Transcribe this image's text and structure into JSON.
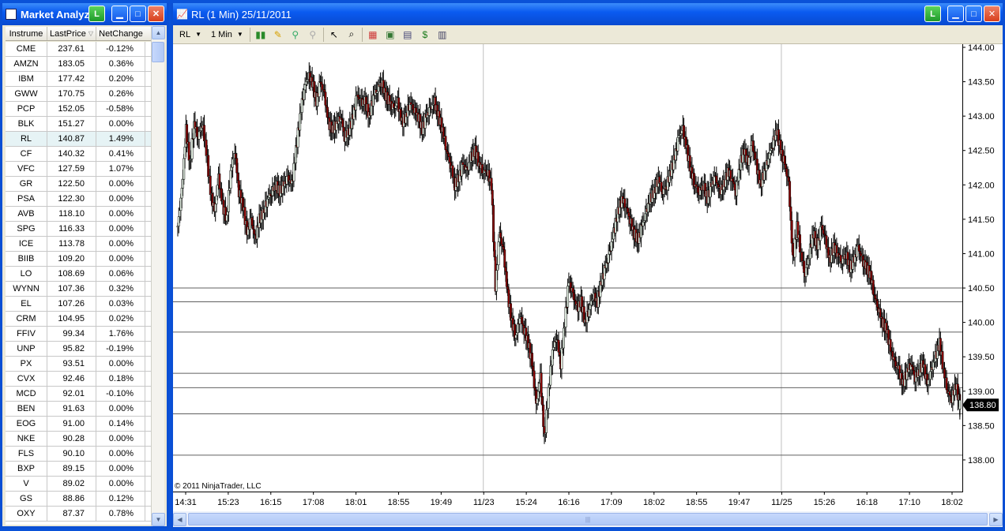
{
  "left_window": {
    "title": "Market Analyz",
    "link_label": "L",
    "columns": [
      "Instrume",
      "LastPrice",
      "NetChange"
    ],
    "rows": [
      [
        "CME",
        "237.61",
        "-0.12%"
      ],
      [
        "AMZN",
        "183.05",
        "0.36%"
      ],
      [
        "IBM",
        "177.42",
        "0.20%"
      ],
      [
        "GWW",
        "170.75",
        "0.26%"
      ],
      [
        "PCP",
        "152.05",
        "-0.58%"
      ],
      [
        "BLK",
        "151.27",
        "0.00%"
      ],
      [
        "RL",
        "140.87",
        "1.49%"
      ],
      [
        "CF",
        "140.32",
        "0.41%"
      ],
      [
        "VFC",
        "127.59",
        "1.07%"
      ],
      [
        "GR",
        "122.50",
        "0.00%"
      ],
      [
        "PSA",
        "122.30",
        "0.00%"
      ],
      [
        "AVB",
        "118.10",
        "0.00%"
      ],
      [
        "SPG",
        "116.33",
        "0.00%"
      ],
      [
        "ICE",
        "113.78",
        "0.00%"
      ],
      [
        "BIIB",
        "109.20",
        "0.00%"
      ],
      [
        "LO",
        "108.69",
        "0.06%"
      ],
      [
        "WYNN",
        "107.36",
        "0.32%"
      ],
      [
        "EL",
        "107.26",
        "0.03%"
      ],
      [
        "CRM",
        "104.95",
        "0.02%"
      ],
      [
        "FFIV",
        "99.34",
        "1.76%"
      ],
      [
        "UNP",
        "95.82",
        "-0.19%"
      ],
      [
        "PX",
        "93.51",
        "0.00%"
      ],
      [
        "CVX",
        "92.46",
        "0.18%"
      ],
      [
        "MCD",
        "92.01",
        "-0.10%"
      ],
      [
        "BEN",
        "91.63",
        "0.00%"
      ],
      [
        "EOG",
        "91.00",
        "0.14%"
      ],
      [
        "NKE",
        "90.28",
        "0.00%"
      ],
      [
        "FLS",
        "90.10",
        "0.00%"
      ],
      [
        "BXP",
        "89.15",
        "0.00%"
      ],
      [
        "V",
        "89.02",
        "0.00%"
      ],
      [
        "GS",
        "88.86",
        "0.12%"
      ],
      [
        "OXY",
        "87.37",
        "0.78%"
      ]
    ],
    "selected_index": 6
  },
  "right_window": {
    "title": "RL (1 Min)  25/11/2011",
    "link_label": "L",
    "toolbar": {
      "instrument": "RL",
      "interval": "1 Min"
    },
    "copyright": "© 2011 NinjaTrader, LLC",
    "last_price_label": "138.80"
  },
  "chart_data": {
    "type": "candlestick",
    "x_ticks": [
      "14:31",
      "15:23",
      "16:15",
      "17:08",
      "18:01",
      "18:55",
      "19:49",
      "11/23",
      "15:24",
      "16:16",
      "17:09",
      "18:02",
      "18:55",
      "19:47",
      "11/25",
      "15:26",
      "16:18",
      "17:10",
      "18:02"
    ],
    "y_ticks": [
      "144.00",
      "143.50",
      "143.00",
      "142.50",
      "142.00",
      "141.50",
      "141.00",
      "140.50",
      "140.00",
      "139.50",
      "139.00",
      "138.50",
      "138.00"
    ],
    "ylim": [
      137.85,
      144.0
    ],
    "session_breaks": [
      "11/23",
      "11/25"
    ],
    "horizontal_lines": [
      140.5,
      140.3,
      139.86,
      139.26,
      139.05,
      138.67,
      138.07
    ],
    "close_path": [
      [
        0,
        141.4
      ],
      [
        0.005,
        141.9
      ],
      [
        0.01,
        142.8
      ],
      [
        0.015,
        142.3
      ],
      [
        0.02,
        142.9
      ],
      [
        0.025,
        142.7
      ],
      [
        0.03,
        142.9
      ],
      [
        0.035,
        142.5
      ],
      [
        0.04,
        141.9
      ],
      [
        0.045,
        141.6
      ],
      [
        0.05,
        142.1
      ],
      [
        0.055,
        141.7
      ],
      [
        0.06,
        141.5
      ],
      [
        0.065,
        142.2
      ],
      [
        0.07,
        142.5
      ],
      [
        0.075,
        141.9
      ],
      [
        0.08,
        141.7
      ],
      [
        0.085,
        141.3
      ],
      [
        0.09,
        141.5
      ],
      [
        0.095,
        141.2
      ],
      [
        0.1,
        141.5
      ],
      [
        0.105,
        141.6
      ],
      [
        0.11,
        141.8
      ],
      [
        0.115,
        141.9
      ],
      [
        0.12,
        142.0
      ],
      [
        0.125,
        141.9
      ],
      [
        0.13,
        142.0
      ],
      [
        0.135,
        142.1
      ],
      [
        0.14,
        142.0
      ],
      [
        0.145,
        142.5
      ],
      [
        0.15,
        143.0
      ],
      [
        0.155,
        143.4
      ],
      [
        0.16,
        143.6
      ],
      [
        0.165,
        143.5
      ],
      [
        0.17,
        143.2
      ],
      [
        0.175,
        143.5
      ],
      [
        0.18,
        143.3
      ],
      [
        0.185,
        142.9
      ],
      [
        0.19,
        142.8
      ],
      [
        0.195,
        142.9
      ],
      [
        0.2,
        143.0
      ],
      [
        0.205,
        142.7
      ],
      [
        0.21,
        142.8
      ],
      [
        0.215,
        143.0
      ],
      [
        0.22,
        143.3
      ],
      [
        0.225,
        143.2
      ],
      [
        0.23,
        143.2
      ],
      [
        0.235,
        143.0
      ],
      [
        0.24,
        143.3
      ],
      [
        0.245,
        143.4
      ],
      [
        0.25,
        143.5
      ],
      [
        0.255,
        143.3
      ],
      [
        0.26,
        143.2
      ],
      [
        0.265,
        143.1
      ],
      [
        0.27,
        143.2
      ],
      [
        0.275,
        142.9
      ],
      [
        0.28,
        143.0
      ],
      [
        0.285,
        143.2
      ],
      [
        0.29,
        143.1
      ],
      [
        0.295,
        143.0
      ],
      [
        0.3,
        142.8
      ],
      [
        0.305,
        143.0
      ],
      [
        0.31,
        143.1
      ],
      [
        0.315,
        143.2
      ],
      [
        0.32,
        143.0
      ],
      [
        0.325,
        142.8
      ],
      [
        0.33,
        142.5
      ],
      [
        0.335,
        142.3
      ],
      [
        0.34,
        142.0
      ],
      [
        0.345,
        142.1
      ],
      [
        0.35,
        142.3
      ],
      [
        0.355,
        142.2
      ],
      [
        0.36,
        142.4
      ],
      [
        0.365,
        142.5
      ],
      [
        0.37,
        142.3
      ],
      [
        0.375,
        142.2
      ],
      [
        0.38,
        142.2
      ],
      [
        0.385,
        142.0
      ],
      [
        0.39,
        140.5
      ],
      [
        0.395,
        141.3
      ],
      [
        0.4,
        141.0
      ],
      [
        0.405,
        140.4
      ],
      [
        0.41,
        140.0
      ],
      [
        0.415,
        139.8
      ],
      [
        0.42,
        140.1
      ],
      [
        0.425,
        139.9
      ],
      [
        0.43,
        139.7
      ],
      [
        0.435,
        139.4
      ],
      [
        0.44,
        138.8
      ],
      [
        0.445,
        139.2
      ],
      [
        0.45,
        138.3
      ],
      [
        0.455,
        139.0
      ],
      [
        0.46,
        139.6
      ],
      [
        0.465,
        139.8
      ],
      [
        0.47,
        139.4
      ],
      [
        0.475,
        140.0
      ],
      [
        0.48,
        140.6
      ],
      [
        0.485,
        140.4
      ],
      [
        0.49,
        140.2
      ],
      [
        0.495,
        140.3
      ],
      [
        0.5,
        140.0
      ],
      [
        0.505,
        140.2
      ],
      [
        0.51,
        140.4
      ],
      [
        0.515,
        140.3
      ],
      [
        0.52,
        140.6
      ],
      [
        0.525,
        140.8
      ],
      [
        0.53,
        141.0
      ],
      [
        0.535,
        141.3
      ],
      [
        0.54,
        141.6
      ],
      [
        0.545,
        141.8
      ],
      [
        0.55,
        141.7
      ],
      [
        0.555,
        141.5
      ],
      [
        0.56,
        141.3
      ],
      [
        0.565,
        141.2
      ],
      [
        0.57,
        141.4
      ],
      [
        0.575,
        141.6
      ],
      [
        0.58,
        141.8
      ],
      [
        0.585,
        141.9
      ],
      [
        0.59,
        142.1
      ],
      [
        0.595,
        141.9
      ],
      [
        0.6,
        142.0
      ],
      [
        0.605,
        142.2
      ],
      [
        0.61,
        142.4
      ],
      [
        0.615,
        142.7
      ],
      [
        0.62,
        142.8
      ],
      [
        0.625,
        142.5
      ],
      [
        0.63,
        142.2
      ],
      [
        0.635,
        142.0
      ],
      [
        0.64,
        141.9
      ],
      [
        0.645,
        142.0
      ],
      [
        0.65,
        141.8
      ],
      [
        0.655,
        142.0
      ],
      [
        0.66,
        142.1
      ],
      [
        0.665,
        141.9
      ],
      [
        0.67,
        142.0
      ],
      [
        0.675,
        142.2
      ],
      [
        0.68,
        142.1
      ],
      [
        0.685,
        141.9
      ],
      [
        0.69,
        142.3
      ],
      [
        0.695,
        142.5
      ],
      [
        0.7,
        142.3
      ],
      [
        0.705,
        142.6
      ],
      [
        0.71,
        142.3
      ],
      [
        0.715,
        142.0
      ],
      [
        0.72,
        142.2
      ],
      [
        0.725,
        142.4
      ],
      [
        0.73,
        142.6
      ],
      [
        0.735,
        142.8
      ],
      [
        0.74,
        142.5
      ],
      [
        0.745,
        142.3
      ],
      [
        0.75,
        142.0
      ],
      [
        0.755,
        140.9
      ],
      [
        0.76,
        141.4
      ],
      [
        0.765,
        141.0
      ],
      [
        0.77,
        140.7
      ],
      [
        0.775,
        141.0
      ],
      [
        0.78,
        141.3
      ],
      [
        0.785,
        141.1
      ],
      [
        0.79,
        141.4
      ],
      [
        0.795,
        141.2
      ],
      [
        0.8,
        140.9
      ],
      [
        0.805,
        141.1
      ],
      [
        0.81,
        141.0
      ],
      [
        0.815,
        140.9
      ],
      [
        0.82,
        141.0
      ],
      [
        0.825,
        140.8
      ],
      [
        0.83,
        140.9
      ],
      [
        0.835,
        141.1
      ],
      [
        0.84,
        140.9
      ],
      [
        0.845,
        140.8
      ],
      [
        0.85,
        140.7
      ],
      [
        0.855,
        140.4
      ],
      [
        0.86,
        140.2
      ],
      [
        0.865,
        140.0
      ],
      [
        0.87,
        139.9
      ],
      [
        0.875,
        139.6
      ],
      [
        0.88,
        139.4
      ],
      [
        0.885,
        139.3
      ],
      [
        0.89,
        139.1
      ],
      [
        0.895,
        139.3
      ],
      [
        0.9,
        139.4
      ],
      [
        0.905,
        139.2
      ],
      [
        0.91,
        139.3
      ],
      [
        0.915,
        139.4
      ],
      [
        0.92,
        139.1
      ],
      [
        0.925,
        139.3
      ],
      [
        0.93,
        139.5
      ],
      [
        0.935,
        139.7
      ],
      [
        0.94,
        139.3
      ],
      [
        0.945,
        139.0
      ],
      [
        0.95,
        138.9
      ],
      [
        0.955,
        139.1
      ],
      [
        0.96,
        138.8
      ]
    ]
  }
}
